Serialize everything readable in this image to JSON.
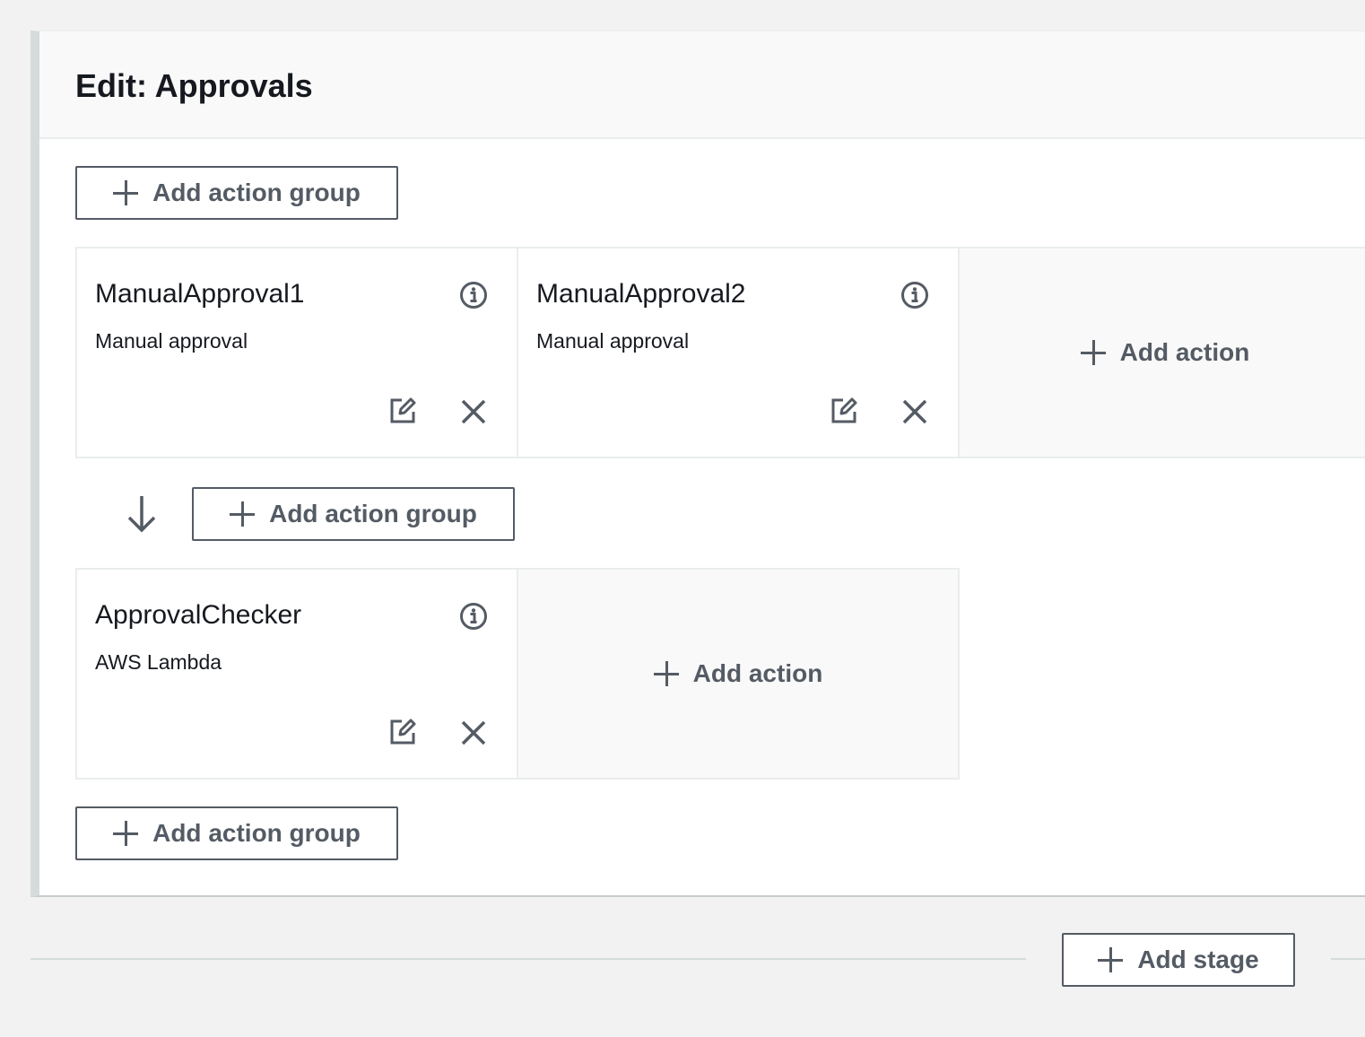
{
  "stage": {
    "title": "Edit: Approvals",
    "add_action_group_label": "Add action group",
    "add_action_label": "Add action",
    "groups": [
      {
        "actions": [
          {
            "name": "ManualApproval1",
            "provider": "Manual approval"
          },
          {
            "name": "ManualApproval2",
            "provider": "Manual approval"
          }
        ]
      },
      {
        "actions": [
          {
            "name": "ApprovalChecker",
            "provider": "AWS Lambda"
          }
        ]
      }
    ]
  },
  "add_stage_label": "Add stage",
  "colors": {
    "accent_gray": "#545b64",
    "panel_bg": "#ffffff",
    "page_bg": "#f2f2f2",
    "slot_bg": "#f9f9f9",
    "border": "#eaeded"
  },
  "icons": [
    "plus-icon",
    "info-icon",
    "edit-icon",
    "close-icon",
    "arrow-down-icon"
  ]
}
